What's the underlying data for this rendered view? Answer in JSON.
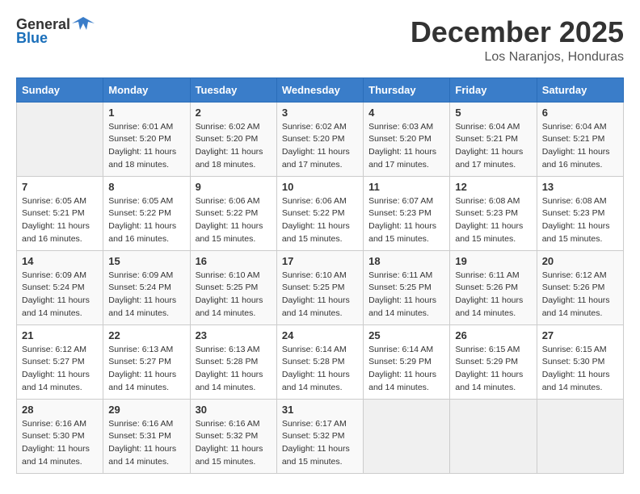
{
  "header": {
    "logo_general": "General",
    "logo_blue": "Blue",
    "month": "December 2025",
    "location": "Los Naranjos, Honduras"
  },
  "days_of_week": [
    "Sunday",
    "Monday",
    "Tuesday",
    "Wednesday",
    "Thursday",
    "Friday",
    "Saturday"
  ],
  "weeks": [
    [
      {
        "day": "",
        "sunrise": "",
        "sunset": "",
        "daylight": ""
      },
      {
        "day": "1",
        "sunrise": "6:01 AM",
        "sunset": "5:20 PM",
        "daylight": "11 hours and 18 minutes."
      },
      {
        "day": "2",
        "sunrise": "6:02 AM",
        "sunset": "5:20 PM",
        "daylight": "11 hours and 18 minutes."
      },
      {
        "day": "3",
        "sunrise": "6:02 AM",
        "sunset": "5:20 PM",
        "daylight": "11 hours and 17 minutes."
      },
      {
        "day": "4",
        "sunrise": "6:03 AM",
        "sunset": "5:20 PM",
        "daylight": "11 hours and 17 minutes."
      },
      {
        "day": "5",
        "sunrise": "6:04 AM",
        "sunset": "5:21 PM",
        "daylight": "11 hours and 17 minutes."
      },
      {
        "day": "6",
        "sunrise": "6:04 AM",
        "sunset": "5:21 PM",
        "daylight": "11 hours and 16 minutes."
      }
    ],
    [
      {
        "day": "7",
        "sunrise": "6:05 AM",
        "sunset": "5:21 PM",
        "daylight": "11 hours and 16 minutes."
      },
      {
        "day": "8",
        "sunrise": "6:05 AM",
        "sunset": "5:22 PM",
        "daylight": "11 hours and 16 minutes."
      },
      {
        "day": "9",
        "sunrise": "6:06 AM",
        "sunset": "5:22 PM",
        "daylight": "11 hours and 15 minutes."
      },
      {
        "day": "10",
        "sunrise": "6:06 AM",
        "sunset": "5:22 PM",
        "daylight": "11 hours and 15 minutes."
      },
      {
        "day": "11",
        "sunrise": "6:07 AM",
        "sunset": "5:23 PM",
        "daylight": "11 hours and 15 minutes."
      },
      {
        "day": "12",
        "sunrise": "6:08 AM",
        "sunset": "5:23 PM",
        "daylight": "11 hours and 15 minutes."
      },
      {
        "day": "13",
        "sunrise": "6:08 AM",
        "sunset": "5:23 PM",
        "daylight": "11 hours and 15 minutes."
      }
    ],
    [
      {
        "day": "14",
        "sunrise": "6:09 AM",
        "sunset": "5:24 PM",
        "daylight": "11 hours and 14 minutes."
      },
      {
        "day": "15",
        "sunrise": "6:09 AM",
        "sunset": "5:24 PM",
        "daylight": "11 hours and 14 minutes."
      },
      {
        "day": "16",
        "sunrise": "6:10 AM",
        "sunset": "5:25 PM",
        "daylight": "11 hours and 14 minutes."
      },
      {
        "day": "17",
        "sunrise": "6:10 AM",
        "sunset": "5:25 PM",
        "daylight": "11 hours and 14 minutes."
      },
      {
        "day": "18",
        "sunrise": "6:11 AM",
        "sunset": "5:25 PM",
        "daylight": "11 hours and 14 minutes."
      },
      {
        "day": "19",
        "sunrise": "6:11 AM",
        "sunset": "5:26 PM",
        "daylight": "11 hours and 14 minutes."
      },
      {
        "day": "20",
        "sunrise": "6:12 AM",
        "sunset": "5:26 PM",
        "daylight": "11 hours and 14 minutes."
      }
    ],
    [
      {
        "day": "21",
        "sunrise": "6:12 AM",
        "sunset": "5:27 PM",
        "daylight": "11 hours and 14 minutes."
      },
      {
        "day": "22",
        "sunrise": "6:13 AM",
        "sunset": "5:27 PM",
        "daylight": "11 hours and 14 minutes."
      },
      {
        "day": "23",
        "sunrise": "6:13 AM",
        "sunset": "5:28 PM",
        "daylight": "11 hours and 14 minutes."
      },
      {
        "day": "24",
        "sunrise": "6:14 AM",
        "sunset": "5:28 PM",
        "daylight": "11 hours and 14 minutes."
      },
      {
        "day": "25",
        "sunrise": "6:14 AM",
        "sunset": "5:29 PM",
        "daylight": "11 hours and 14 minutes."
      },
      {
        "day": "26",
        "sunrise": "6:15 AM",
        "sunset": "5:29 PM",
        "daylight": "11 hours and 14 minutes."
      },
      {
        "day": "27",
        "sunrise": "6:15 AM",
        "sunset": "5:30 PM",
        "daylight": "11 hours and 14 minutes."
      }
    ],
    [
      {
        "day": "28",
        "sunrise": "6:16 AM",
        "sunset": "5:30 PM",
        "daylight": "11 hours and 14 minutes."
      },
      {
        "day": "29",
        "sunrise": "6:16 AM",
        "sunset": "5:31 PM",
        "daylight": "11 hours and 14 minutes."
      },
      {
        "day": "30",
        "sunrise": "6:16 AM",
        "sunset": "5:32 PM",
        "daylight": "11 hours and 15 minutes."
      },
      {
        "day": "31",
        "sunrise": "6:17 AM",
        "sunset": "5:32 PM",
        "daylight": "11 hours and 15 minutes."
      },
      {
        "day": "",
        "sunrise": "",
        "sunset": "",
        "daylight": ""
      },
      {
        "day": "",
        "sunrise": "",
        "sunset": "",
        "daylight": ""
      },
      {
        "day": "",
        "sunrise": "",
        "sunset": "",
        "daylight": ""
      }
    ]
  ],
  "labels": {
    "sunrise_prefix": "Sunrise: ",
    "sunset_prefix": "Sunset: ",
    "daylight_prefix": "Daylight: "
  }
}
